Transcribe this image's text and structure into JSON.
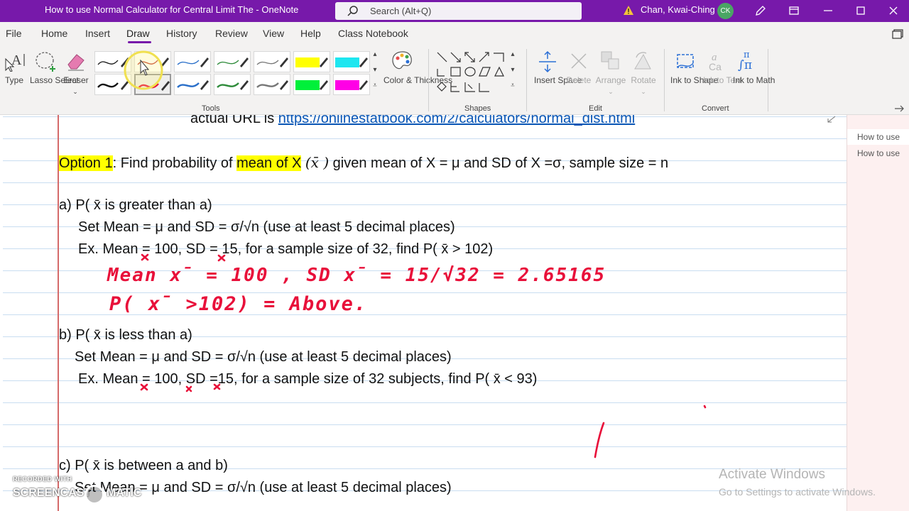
{
  "window": {
    "title": "How to use Normal Calculator for Central Limit The  -  OneNote",
    "search_placeholder": "Search (Alt+Q)",
    "user_name": "Chan, Kwai-Ching",
    "user_initials": "CK",
    "accent_color": "#7719aa"
  },
  "menu": {
    "tabs": [
      "File",
      "Home",
      "Insert",
      "Draw",
      "History",
      "Review",
      "View",
      "Help",
      "Class Notebook"
    ],
    "active_tab": "Draw"
  },
  "ribbon": {
    "type_label": "Type",
    "lasso_label": "Lasso Select",
    "eraser_label": "Eraser",
    "tools_group": "Tools",
    "color_thickness_label": "Color & Thickness",
    "shapes_group": "Shapes",
    "insert_space_label": "Insert Space",
    "delete_label": "Delete",
    "arrange_label": "Arrange",
    "rotate_label": "Rotate",
    "edit_group": "Edit",
    "ink_to_shape_label": "Ink to Shape",
    "ink_to_text_label": "Ink to Text",
    "ink_to_math_label": "Ink to Math",
    "convert_group": "Convert"
  },
  "right_pane": {
    "pages": [
      "How to use",
      "How to use"
    ]
  },
  "note": {
    "url_prefix": "actual URL is ",
    "url": "https://onlinestatbook.com/2/calculators/normal_dist.html",
    "option_label": "Option 1",
    "option_mid": ": Find probability of ",
    "option_highlight": "mean of X",
    "option_xbar": "(x̄ )",
    "option_rest": " given mean of X = μ and SD of X =σ, sample size = n",
    "a_head": "a) P( x̄ is greater than a)",
    "a_set": "Set Mean = μ  and  SD =  σ/√n  (use at least 5 decimal places)",
    "a_ex": "Ex. Mean = 100, SD = 15, for a sample size of 32, find P(  x̄ > 102)",
    "b_head": "b) P(  x̄ is less than a)",
    "b_set": "Set Mean = μ  and  SD =  σ/√n  (use at least 5 decimal places)",
    "b_ex": "Ex. Mean = 100, SD =15, for a sample size of  32 subjects, find P(  x̄ < 93)",
    "c_head": "c) P(  x̄ is between a and b)",
    "c_set": "Set Mean = μ  and  SD =  σ/√n  (use at least 5 decimal places)"
  },
  "ink": {
    "line1": "Mean x̄ = 100 , SD x̄ = 15/√32 = 2.65165",
    "line2": "P( x̄ >102) = Above.",
    "color": "#e8103a"
  },
  "overlay": {
    "activate_title": "Activate Windows",
    "activate_sub": "Go to Settings to activate Windows.",
    "recorded_with": "RECORDED WITH",
    "screencast_a": "SCREENCAST",
    "screencast_b": "MATIC"
  }
}
